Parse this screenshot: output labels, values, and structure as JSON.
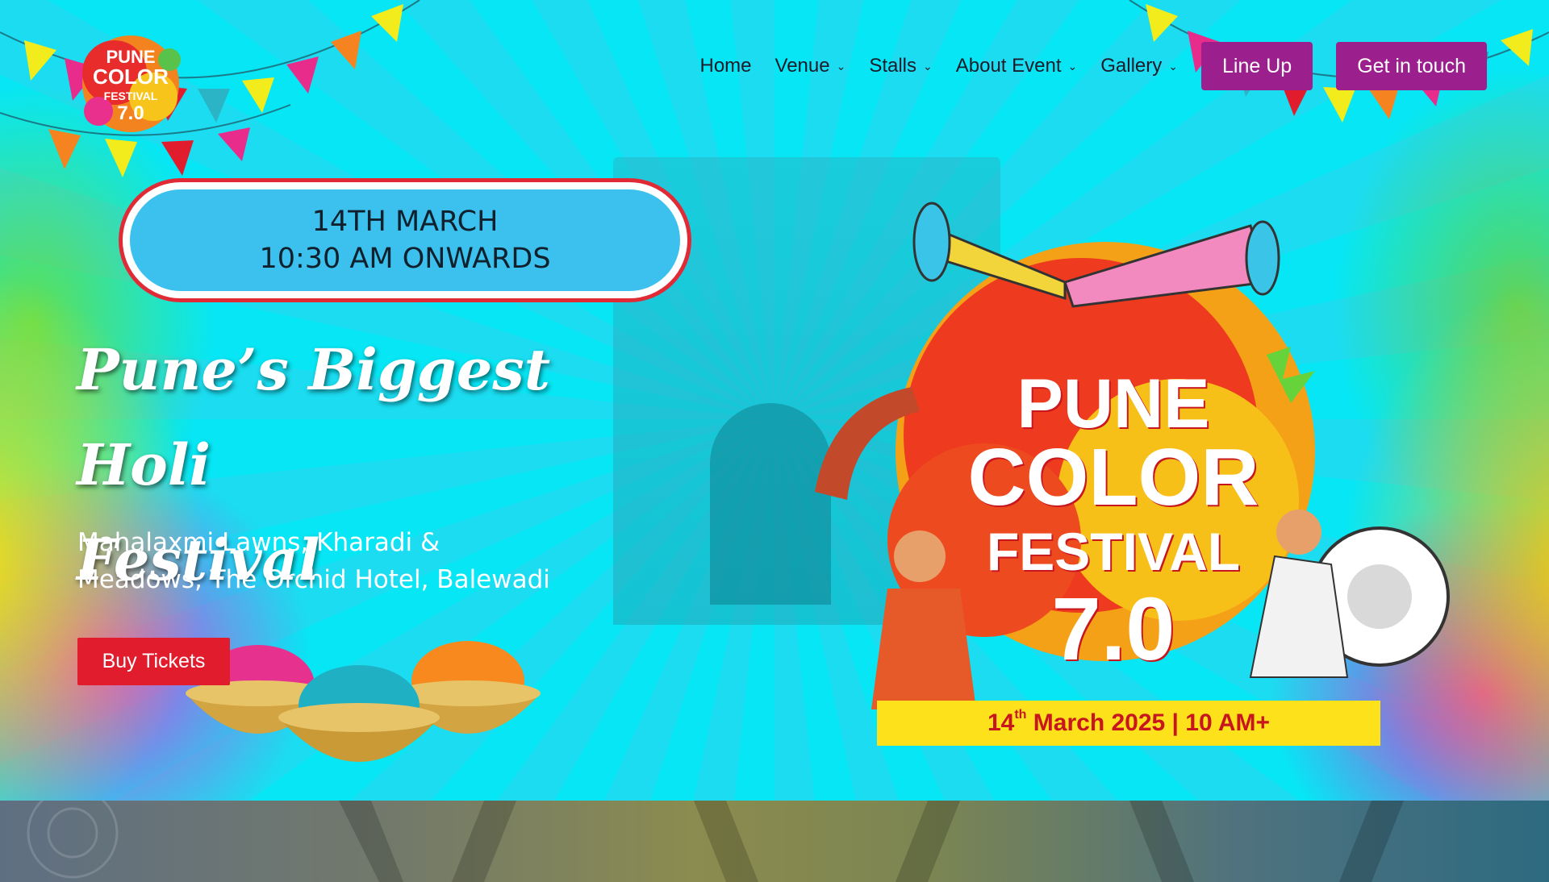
{
  "nav": {
    "logo": {
      "line1": "PUNE",
      "line2": "COLOR",
      "line3": "FESTIVAL",
      "line4": "7.0"
    },
    "items": [
      {
        "label": "Home",
        "has_dropdown": false
      },
      {
        "label": "Venue",
        "has_dropdown": true
      },
      {
        "label": "Stalls",
        "has_dropdown": true
      },
      {
        "label": "About Event",
        "has_dropdown": true
      },
      {
        "label": "Gallery",
        "has_dropdown": true
      }
    ],
    "lineup_label": "Line Up",
    "contact_label": "Get in touch",
    "button_color": "#9b1f8c"
  },
  "hero": {
    "date_line1": "14TH MARCH",
    "date_line2": "10:30 AM ONWARDS",
    "headline_line1": "Pune’s Biggest Holi",
    "headline_line2": "Festival",
    "venue_line1": "Mahalaxmi Lawns, Kharadi &",
    "venue_line2": "Meadows, The Orchid Hotel, Balewadi",
    "buy_label": "Buy Tickets",
    "buy_color": "#e11d2d"
  },
  "art": {
    "title_line1": "PUNE",
    "title_line2": "COLOR",
    "title_line3": "FESTIVAL",
    "title_line4": "7.0",
    "date_day": "14",
    "date_suffix": "th",
    "date_rest": "March 2025 | 10 AM+"
  },
  "icons": [
    "chevron-down-icon",
    "tutari-horn-icon",
    "dhol-drum-icon",
    "color-powder-bowls-icon",
    "bunting-flags-icon"
  ]
}
